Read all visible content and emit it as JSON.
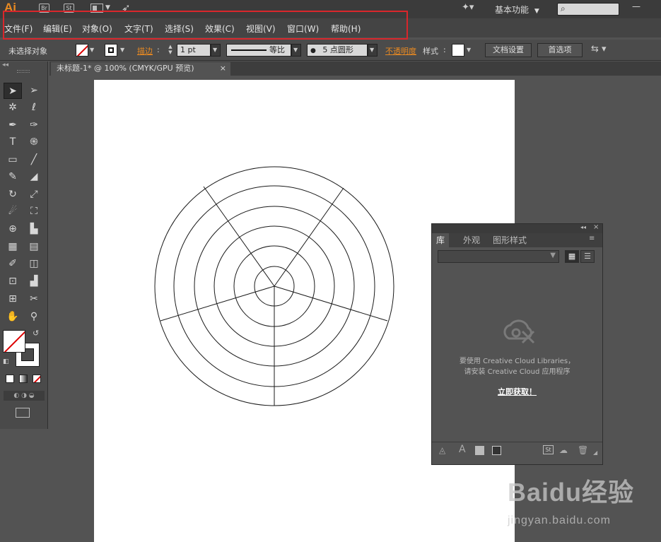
{
  "app": {
    "logo": "Ai",
    "br_label": "Br",
    "st_label": "St"
  },
  "workspace": {
    "label": "基本功能",
    "search_icon": "⌕"
  },
  "menubar": {
    "items": [
      "文件(F)",
      "编辑(E)",
      "对象(O)",
      "文字(T)",
      "选择(S)",
      "效果(C)",
      "视图(V)",
      "窗口(W)",
      "帮助(H)"
    ]
  },
  "controlbar": {
    "no_selection": "未选择对象",
    "stroke_label": "描边",
    "stroke_weight": "1 pt",
    "profile_label": "等比",
    "brush_label": "5 点圆形",
    "opacity_label": "不透明度",
    "style_label": "样式",
    "doc_setup_button": "文档设置",
    "prefs_button": "首选项"
  },
  "document": {
    "tab_title": "未标题-1* @ 100% (CMYK/GPU 预览)",
    "close": "×"
  },
  "toolbar": {
    "tools": [
      "selection",
      "direct-selection",
      "magic-wand",
      "lasso",
      "pen",
      "curvature",
      "type",
      "spiral",
      "rectangle",
      "paintbrush",
      "pencil",
      "eraser",
      "rotate",
      "scale",
      "warp",
      "free-transform",
      "shape-builder",
      "chart",
      "mesh",
      "gradient",
      "eyedropper",
      "blend",
      "symbol-sprayer",
      "column-graph",
      "artboard",
      "slice",
      "hand",
      "zoom"
    ]
  },
  "library_panel": {
    "tabs": [
      "库",
      "外观",
      "图形样式"
    ],
    "message_line1": "要使用 Creative Cloud Libraries，",
    "message_line2": "请安装 Creative Cloud 应用程序",
    "link": "立即获取！",
    "footer_st": "St"
  },
  "watermark": {
    "brand": "Baidu经验",
    "url": "jingyan.baidu.com"
  },
  "colors": {
    "accent_orange": "#e98a22",
    "highlight_red": "#d9262b",
    "ui_dark": "#535353"
  }
}
